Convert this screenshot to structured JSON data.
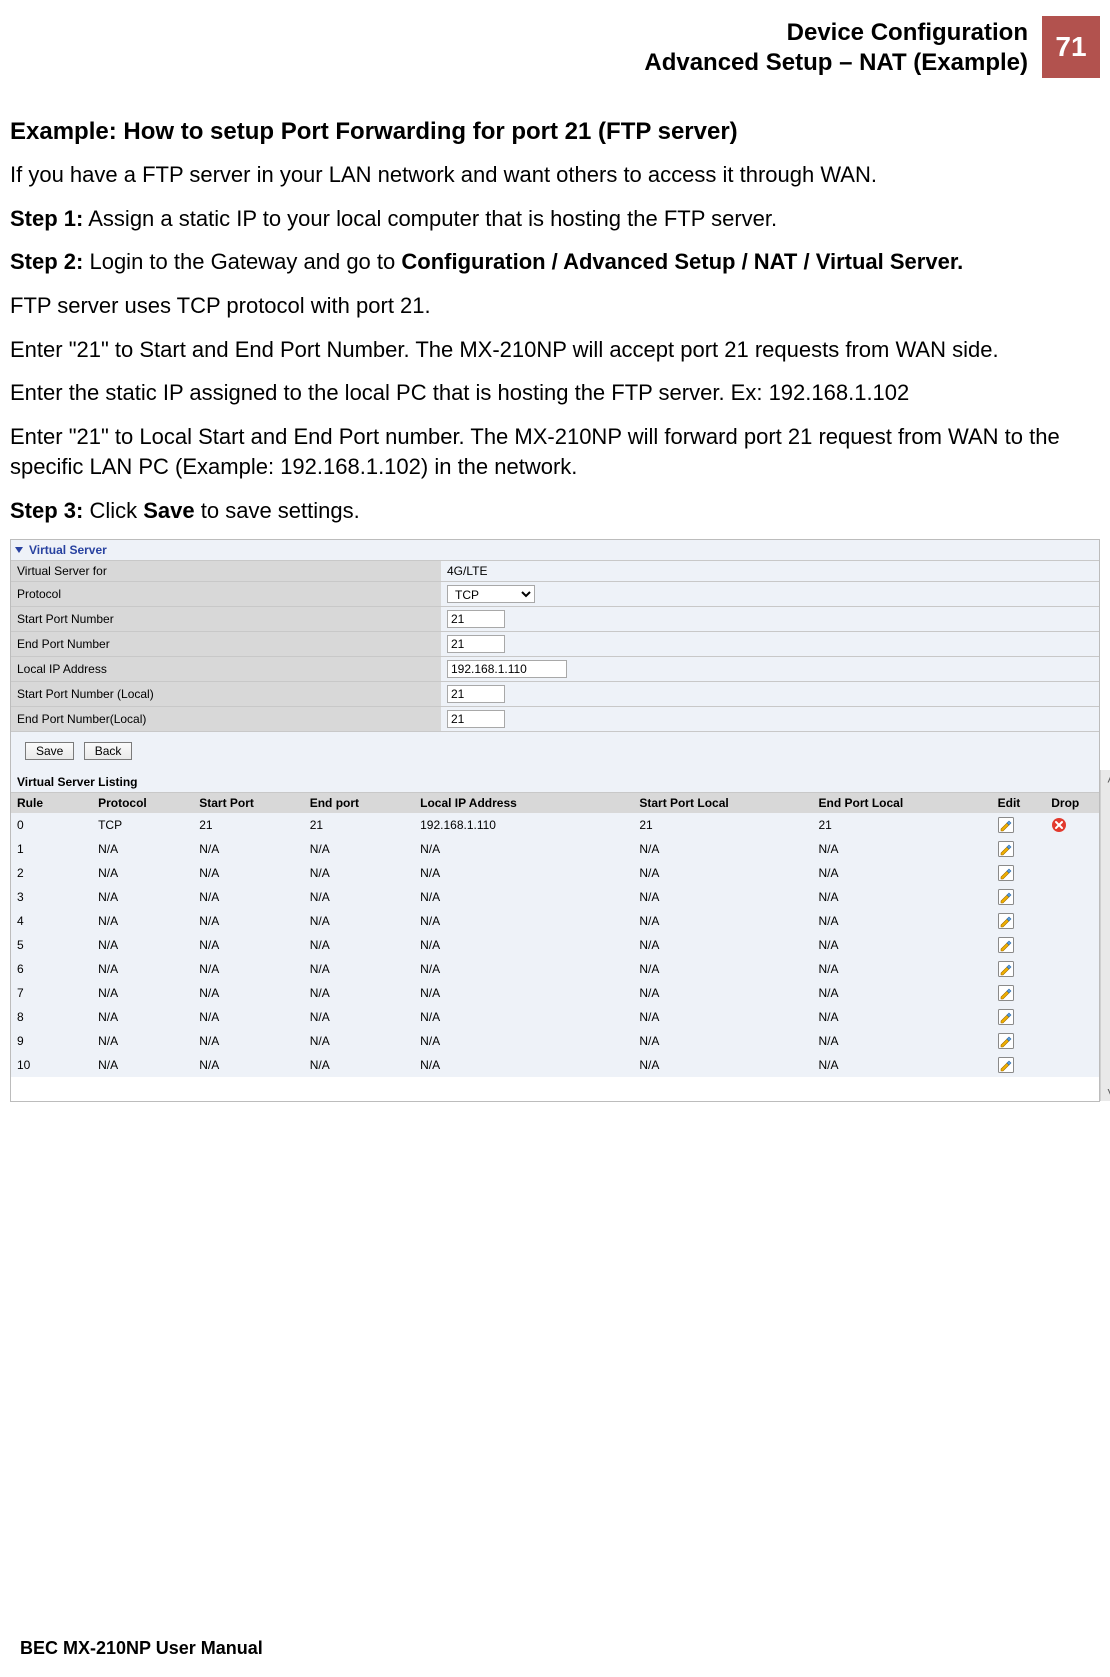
{
  "header": {
    "title_line1": "Device Configuration",
    "title_line2": "Advanced Setup – NAT (Example)",
    "page_number": "71"
  },
  "body": {
    "heading": "Example: How to setup Port Forwarding for port 21 (FTP server)",
    "p_intro": "If you have a FTP server in your LAN network and want others to access it through WAN.",
    "step1_label": "Step 1:",
    "step1_text": "  Assign a static IP to your local computer that is hosting the FTP server.",
    "step2_label": "Step 2:",
    "step2_text_a": "  Login to the Gateway and go to ",
    "step2_bold": "Configuration / Advanced Setup / NAT / Virtual Server.",
    "p_proto": "FTP server uses TCP protocol with port 21.",
    "p_ports": "Enter \"21\" to Start and End Port Number.  The MX-210NP will accept port 21 requests from WAN side.",
    "p_static": "Enter the static IP assigned to the local PC that is hosting the FTP server. Ex: 192.168.1.102",
    "p_local": "Enter \"21\" to Local Start and End Port number. The MX-210NP will forward port 21 request from WAN to the specific LAN PC (Example: 192.168.1.102) in the network.",
    "step3_label": "Step 3:",
    "step3_text_a": " Click ",
    "step3_bold": "Save",
    "step3_text_b": " to save settings."
  },
  "form": {
    "section_title": "Virtual Server",
    "rows": {
      "virtual_server_for": {
        "label": "Virtual Server for",
        "value": "4G/LTE"
      },
      "protocol": {
        "label": "Protocol",
        "value": "TCP"
      },
      "start_port": {
        "label": "Start Port Number",
        "value": "21"
      },
      "end_port": {
        "label": "End Port Number",
        "value": "21"
      },
      "local_ip": {
        "label": "Local IP Address",
        "value": "192.168.1.110"
      },
      "start_port_local": {
        "label": "Start Port Number (Local)",
        "value": "21"
      },
      "end_port_local": {
        "label": "End Port Number(Local)",
        "value": "21"
      }
    },
    "buttons": {
      "save": "Save",
      "back": "Back"
    }
  },
  "listing": {
    "title": "Virtual Server Listing",
    "columns": [
      "Rule",
      "Protocol",
      "Start Port",
      "End port",
      "Local IP Address",
      "Start Port Local",
      "End Port Local",
      "Edit",
      "Drop"
    ],
    "rows": [
      {
        "rule": "0",
        "protocol": "TCP",
        "start": "21",
        "end": "21",
        "ip": "192.168.1.110",
        "start_local": "21",
        "end_local": "21",
        "has_drop": true
      },
      {
        "rule": "1",
        "protocol": "N/A",
        "start": "N/A",
        "end": "N/A",
        "ip": "N/A",
        "start_local": "N/A",
        "end_local": "N/A",
        "has_drop": false
      },
      {
        "rule": "2",
        "protocol": "N/A",
        "start": "N/A",
        "end": "N/A",
        "ip": "N/A",
        "start_local": "N/A",
        "end_local": "N/A",
        "has_drop": false
      },
      {
        "rule": "3",
        "protocol": "N/A",
        "start": "N/A",
        "end": "N/A",
        "ip": "N/A",
        "start_local": "N/A",
        "end_local": "N/A",
        "has_drop": false
      },
      {
        "rule": "4",
        "protocol": "N/A",
        "start": "N/A",
        "end": "N/A",
        "ip": "N/A",
        "start_local": "N/A",
        "end_local": "N/A",
        "has_drop": false
      },
      {
        "rule": "5",
        "protocol": "N/A",
        "start": "N/A",
        "end": "N/A",
        "ip": "N/A",
        "start_local": "N/A",
        "end_local": "N/A",
        "has_drop": false
      },
      {
        "rule": "6",
        "protocol": "N/A",
        "start": "N/A",
        "end": "N/A",
        "ip": "N/A",
        "start_local": "N/A",
        "end_local": "N/A",
        "has_drop": false
      },
      {
        "rule": "7",
        "protocol": "N/A",
        "start": "N/A",
        "end": "N/A",
        "ip": "N/A",
        "start_local": "N/A",
        "end_local": "N/A",
        "has_drop": false
      },
      {
        "rule": "8",
        "protocol": "N/A",
        "start": "N/A",
        "end": "N/A",
        "ip": "N/A",
        "start_local": "N/A",
        "end_local": "N/A",
        "has_drop": false
      },
      {
        "rule": "9",
        "protocol": "N/A",
        "start": "N/A",
        "end": "N/A",
        "ip": "N/A",
        "start_local": "N/A",
        "end_local": "N/A",
        "has_drop": false
      },
      {
        "rule": "10",
        "protocol": "N/A",
        "start": "N/A",
        "end": "N/A",
        "ip": "N/A",
        "start_local": "N/A",
        "end_local": "N/A",
        "has_drop": false
      }
    ]
  },
  "footer": "BEC MX-210NP User Manual",
  "colors": {
    "header_badge_bg": "#b2524e",
    "panel_bg": "#eef2f8",
    "label_bg": "#d8d8d8",
    "panel_title_color": "#2842a0"
  }
}
